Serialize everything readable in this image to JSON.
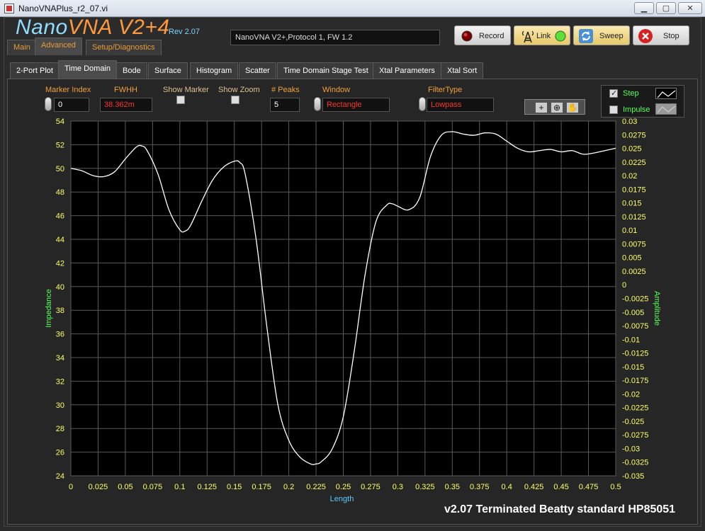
{
  "window": {
    "title": "NanoVNAPlus_r2_07.vi"
  },
  "header": {
    "logo_nano": "Nano",
    "logo_rest": "VNA V2+4",
    "rev": "Rev 2.07",
    "status": "NanoVNA V2+,Protocol 1, FW 1.2"
  },
  "buttons": {
    "record": "Record",
    "link": "Link",
    "sweep": "Sweep",
    "stop": "Stop"
  },
  "top_tabs": [
    "Main",
    "Advanced",
    "Setup/Diagnostics"
  ],
  "sub_tabs": [
    "2-Port Plot",
    "Time Domain",
    "Bode",
    "Surface",
    "Histogram",
    "Scatter",
    "Time Domain Stage Test",
    "Xtal Parameters",
    "Xtal Sort"
  ],
  "controls": {
    "marker_index_label": "Marker Index",
    "marker_index_value": "0",
    "fwhh_label": "FWHH",
    "fwhh_value": "38.362m",
    "show_marker_label": "Show Marker",
    "show_zoom_label": "Show Zoom",
    "peaks_label": "# Peaks",
    "peaks_value": "5",
    "window_label": "Window",
    "window_value": "Rectangle",
    "filter_label": "FilterType",
    "filter_value": "Lowpass"
  },
  "legend": {
    "step": "Step",
    "impulse": "Impulse",
    "step_checked": true,
    "impulse_checked": false
  },
  "colors": {
    "accent": "#f2a03a",
    "axis_label": "#55ff55",
    "tick": "#ffff66",
    "trace": "#ffffff"
  },
  "footer": "v2.07 Terminated Beatty standard HP85051",
  "chart_data": {
    "type": "line",
    "xlabel": "Length",
    "ylabel": "Impedance",
    "y2label": "Amplitude",
    "xlim": [
      0,
      0.5
    ],
    "ylim": [
      24,
      54
    ],
    "y2lim": [
      -0.035,
      0.03
    ],
    "x_ticks": [
      "0",
      "0.025",
      "0.05",
      "0.075",
      "0.1",
      "0.125",
      "0.15",
      "0.175",
      "0.2",
      "0.225",
      "0.25",
      "0.275",
      "0.3",
      "0.325",
      "0.35",
      "0.375",
      "0.4",
      "0.425",
      "0.45",
      "0.475",
      "0.5"
    ],
    "y_ticks": [
      "24",
      "26",
      "28",
      "30",
      "32",
      "34",
      "36",
      "38",
      "40",
      "42",
      "44",
      "46",
      "48",
      "50",
      "52",
      "54"
    ],
    "y2_ticks": [
      "-0.035",
      "-0.0325",
      "-0.03",
      "-0.0275",
      "-0.025",
      "-0.0225",
      "-0.02",
      "-0.0175",
      "-0.015",
      "-0.0125",
      "-0.01",
      "-0.0075",
      "-0.005",
      "-0.0025",
      "0",
      "0.0025",
      "0.005",
      "0.0075",
      "0.01",
      "0.0125",
      "0.015",
      "0.0175",
      "0.02",
      "0.0225",
      "0.025",
      "0.0275",
      "0.03"
    ],
    "grid": true,
    "series": [
      {
        "name": "Step",
        "x": [
          0,
          0.01,
          0.02,
          0.03,
          0.04,
          0.05,
          0.06,
          0.065,
          0.07,
          0.08,
          0.09,
          0.1,
          0.105,
          0.11,
          0.12,
          0.13,
          0.14,
          0.15,
          0.155,
          0.16,
          0.17,
          0.18,
          0.19,
          0.2,
          0.21,
          0.22,
          0.225,
          0.23,
          0.24,
          0.25,
          0.26,
          0.27,
          0.28,
          0.29,
          0.295,
          0.3,
          0.31,
          0.32,
          0.33,
          0.34,
          0.35,
          0.36,
          0.37,
          0.38,
          0.39,
          0.4,
          0.41,
          0.42,
          0.43,
          0.44,
          0.45,
          0.46,
          0.47,
          0.48,
          0.49,
          0.5
        ],
        "y": [
          50.0,
          49.8,
          49.4,
          49.3,
          49.7,
          50.8,
          51.8,
          51.9,
          51.5,
          49.5,
          46.5,
          44.8,
          44.7,
          45.2,
          47.2,
          49.0,
          50.1,
          50.6,
          50.5,
          49.5,
          44.0,
          36.5,
          30.0,
          27.0,
          25.6,
          25.0,
          25.0,
          25.2,
          26.3,
          29.0,
          34.5,
          41.0,
          45.5,
          46.9,
          47.0,
          46.8,
          46.5,
          47.5,
          51.0,
          52.8,
          53.1,
          52.9,
          52.8,
          53.0,
          52.9,
          52.3,
          51.7,
          51.4,
          51.5,
          51.6,
          51.4,
          51.5,
          51.2,
          51.3,
          51.5,
          51.7
        ]
      }
    ]
  }
}
